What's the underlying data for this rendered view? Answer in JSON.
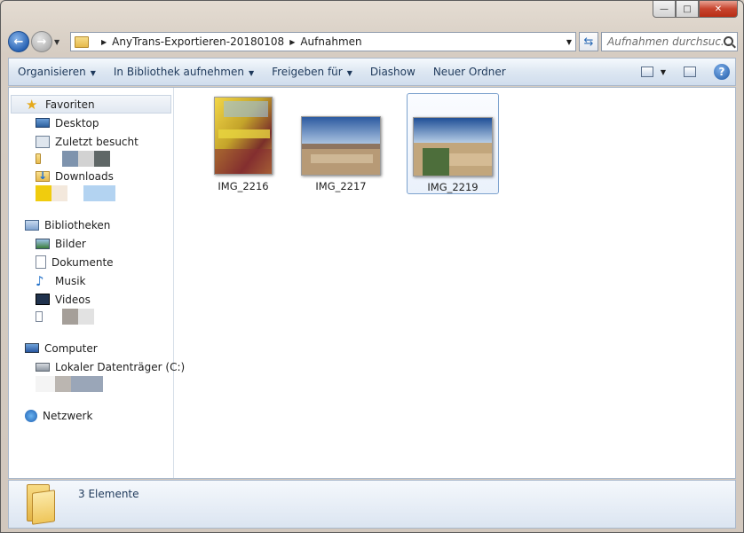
{
  "window": {
    "caption_min": "—",
    "caption_max": "□",
    "caption_close": "✕"
  },
  "address": {
    "segments": [
      "AnyTrans-Exportieren-20180108",
      "Aufnahmen"
    ],
    "search_placeholder": "Aufnahmen durchsuc..."
  },
  "toolbar": {
    "items": [
      "Organisieren",
      "In Bibliothek aufnehmen",
      "Freigeben für",
      "Diashow",
      "Neuer Ordner"
    ]
  },
  "sidebar": {
    "favorites": {
      "label": "Favoriten",
      "items": [
        "Desktop",
        "Zuletzt besucht",
        "Downloads"
      ]
    },
    "libraries": {
      "label": "Bibliotheken",
      "items": [
        "Bilder",
        "Dokumente",
        "Musik",
        "Videos"
      ]
    },
    "computer": {
      "label": "Computer",
      "items": [
        "Lokaler Datenträger (C:)"
      ]
    },
    "network": {
      "label": "Netzwerk"
    }
  },
  "files": [
    {
      "name": "IMG_2216",
      "selected": false
    },
    {
      "name": "IMG_2217",
      "selected": false
    },
    {
      "name": "IMG_2219",
      "selected": true
    }
  ],
  "details": {
    "count_text": "3 Elemente"
  }
}
